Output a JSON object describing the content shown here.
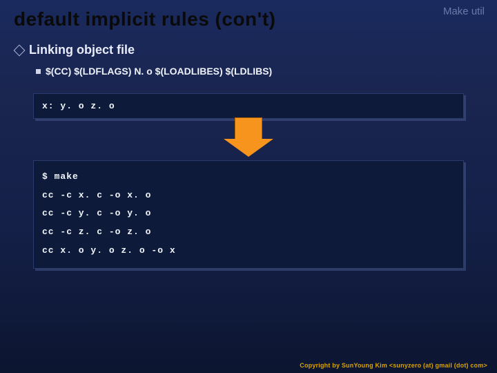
{
  "header": {
    "label": "Make util"
  },
  "title": "default implicit rules (con't)",
  "bullets": {
    "level1": "Linking object file",
    "level2": "$(CC) $(LDFLAGS) N. o $(LOADLIBES) $(LDLIBS)"
  },
  "code_top": "x: y. o z. o",
  "code_bottom": [
    "$ make",
    "cc -c x. c -o x. o",
    "cc -c y. c -o y. o",
    "cc -c z. c -o z. o",
    "cc x. o y. o z. o -o x"
  ],
  "footer": "Copyright by SunYoung Kim <sunyzero (at) gmail (dot) com>"
}
